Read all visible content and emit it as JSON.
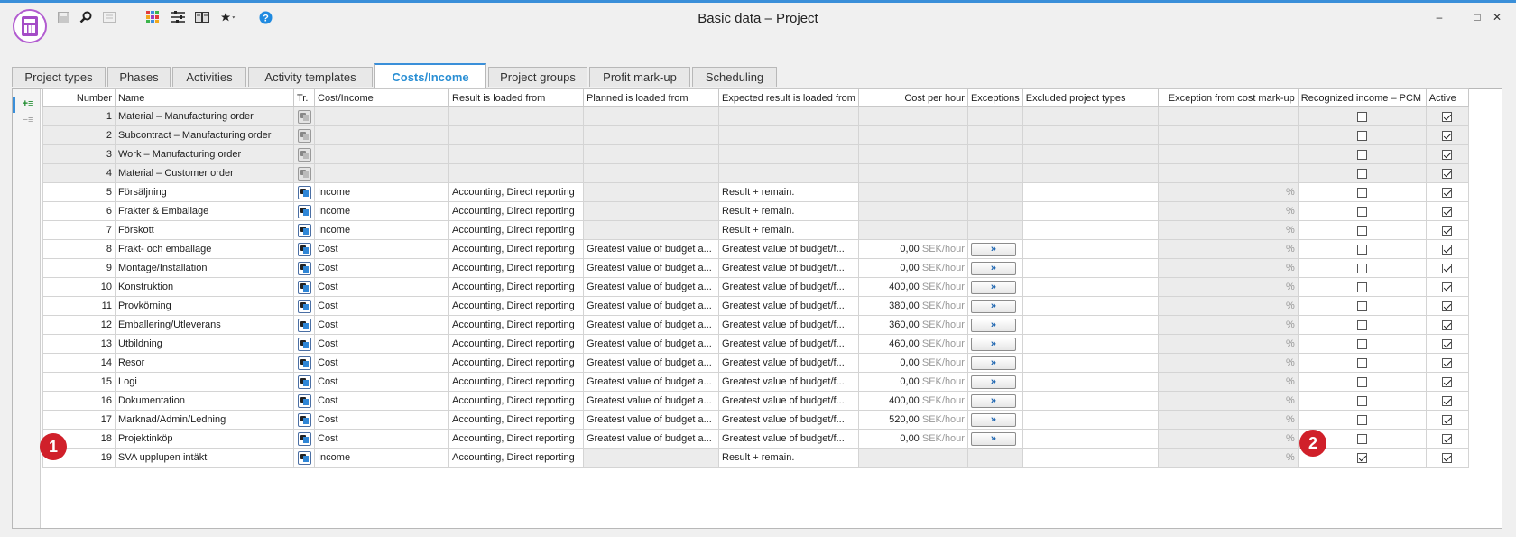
{
  "window": {
    "title": "Basic data – Project"
  },
  "toolbar": {
    "icons": [
      "save-icon",
      "search-icon",
      "details-icon",
      "apps-grid-icon",
      "settings-sliders-icon",
      "book-icon",
      "favorites-star-icon",
      "help-icon"
    ],
    "min_label": "–",
    "max_label": "□",
    "close_label": "✕"
  },
  "tabs": [
    {
      "label": "Project types"
    },
    {
      "label": "Phases"
    },
    {
      "label": "Activities"
    },
    {
      "label": "Activity templates"
    },
    {
      "label": "Costs/Income",
      "active": true
    },
    {
      "label": "Project groups"
    },
    {
      "label": "Profit mark-up"
    },
    {
      "label": "Scheduling"
    }
  ],
  "side": {
    "add_label": "+≡",
    "remove_label": "−≡"
  },
  "grid": {
    "columns": {
      "number": "Number",
      "name": "Name",
      "tr": "Tr.",
      "cost_income": "Cost/Income",
      "result_from": "Result is loaded from",
      "planned_from": "Planned is loaded from",
      "expected_from": "Expected result is loaded from",
      "cost_per_hour": "Cost per hour",
      "exceptions": "Exceptions",
      "excluded": "Excluded project types",
      "exception_markup": "Exception from cost mark-up",
      "recognized": "Recognized income – PCM",
      "active": "Active"
    },
    "unit": "SEK/hour",
    "pct": "%",
    "exceptions_btn": "»",
    "rows": [
      {
        "number": "1",
        "name": "Material – Manufacturing order",
        "type": "",
        "result": "",
        "planned": "",
        "expected": "",
        "cph": "",
        "recognized": false,
        "active": true,
        "system": true
      },
      {
        "number": "2",
        "name": "Subcontract – Manufacturing order",
        "type": "",
        "result": "",
        "planned": "",
        "expected": "",
        "cph": "",
        "recognized": false,
        "active": true,
        "system": true
      },
      {
        "number": "3",
        "name": "Work – Manufacturing order",
        "type": "",
        "result": "",
        "planned": "",
        "expected": "",
        "cph": "",
        "recognized": false,
        "active": true,
        "system": true
      },
      {
        "number": "4",
        "name": "Material – Customer order",
        "type": "",
        "result": "",
        "planned": "",
        "expected": "",
        "cph": "",
        "recognized": false,
        "active": true,
        "system": true
      },
      {
        "number": "5",
        "name": "Försäljning",
        "type": "Income",
        "result": "Accounting, Direct reporting",
        "planned": "",
        "expected": "Result + remain.",
        "cph": "",
        "recognized": false,
        "active": true
      },
      {
        "number": "6",
        "name": "Frakter & Emballage",
        "type": "Income",
        "result": "Accounting, Direct reporting",
        "planned": "",
        "expected": "Result + remain.",
        "cph": "",
        "recognized": false,
        "active": true
      },
      {
        "number": "7",
        "name": "Förskott",
        "type": "Income",
        "result": "Accounting, Direct reporting",
        "planned": "",
        "expected": "Result + remain.",
        "cph": "",
        "recognized": false,
        "active": true
      },
      {
        "number": "8",
        "name": "Frakt- och emballage",
        "type": "Cost",
        "result": "Accounting, Direct reporting",
        "planned": "Greatest value of budget a...",
        "expected": "Greatest value of budget/f...",
        "cph": "0,00",
        "recognized": false,
        "active": true
      },
      {
        "number": "9",
        "name": "Montage/Installation",
        "type": "Cost",
        "result": "Accounting, Direct reporting",
        "planned": "Greatest value of budget a...",
        "expected": "Greatest value of budget/f...",
        "cph": "0,00",
        "recognized": false,
        "active": true
      },
      {
        "number": "10",
        "name": "Konstruktion",
        "type": "Cost",
        "result": "Accounting, Direct reporting",
        "planned": "Greatest value of budget a...",
        "expected": "Greatest value of budget/f...",
        "cph": "400,00",
        "recognized": false,
        "active": true
      },
      {
        "number": "11",
        "name": "Provkörning",
        "type": "Cost",
        "result": "Accounting, Direct reporting",
        "planned": "Greatest value of budget a...",
        "expected": "Greatest value of budget/f...",
        "cph": "380,00",
        "recognized": false,
        "active": true
      },
      {
        "number": "12",
        "name": "Emballering/Utleverans",
        "type": "Cost",
        "result": "Accounting, Direct reporting",
        "planned": "Greatest value of budget a...",
        "expected": "Greatest value of budget/f...",
        "cph": "360,00",
        "recognized": false,
        "active": true
      },
      {
        "number": "13",
        "name": "Utbildning",
        "type": "Cost",
        "result": "Accounting, Direct reporting",
        "planned": "Greatest value of budget a...",
        "expected": "Greatest value of budget/f...",
        "cph": "460,00",
        "recognized": false,
        "active": true
      },
      {
        "number": "14",
        "name": "Resor",
        "type": "Cost",
        "result": "Accounting, Direct reporting",
        "planned": "Greatest value of budget a...",
        "expected": "Greatest value of budget/f...",
        "cph": "0,00",
        "recognized": false,
        "active": true
      },
      {
        "number": "15",
        "name": "Logi",
        "type": "Cost",
        "result": "Accounting, Direct reporting",
        "planned": "Greatest value of budget a...",
        "expected": "Greatest value of budget/f...",
        "cph": "0,00",
        "recognized": false,
        "active": true
      },
      {
        "number": "16",
        "name": "Dokumentation",
        "type": "Cost",
        "result": "Accounting, Direct reporting",
        "planned": "Greatest value of budget a...",
        "expected": "Greatest value of budget/f...",
        "cph": "400,00",
        "recognized": false,
        "active": true
      },
      {
        "number": "17",
        "name": "Marknad/Admin/Ledning",
        "type": "Cost",
        "result": "Accounting, Direct reporting",
        "planned": "Greatest value of budget a...",
        "expected": "Greatest value of budget/f...",
        "cph": "520,00",
        "recognized": false,
        "active": true
      },
      {
        "number": "18",
        "name": "Projektinköp",
        "type": "Cost",
        "result": "Accounting, Direct reporting",
        "planned": "Greatest value of budget a...",
        "expected": "Greatest value of budget/f...",
        "cph": "0,00",
        "recognized": false,
        "active": true
      },
      {
        "number": "19",
        "name": "SVA upplupen intäkt",
        "type": "Income",
        "result": "Accounting, Direct reporting",
        "planned": "",
        "expected": "Result + remain.",
        "cph": "",
        "recognized": true,
        "active": true
      }
    ]
  },
  "badges": [
    {
      "label": "1"
    },
    {
      "label": "2"
    }
  ],
  "colors": {
    "accent": "#3a8fd9",
    "app_icon": "#a44cc7",
    "badge": "#d0202a"
  }
}
